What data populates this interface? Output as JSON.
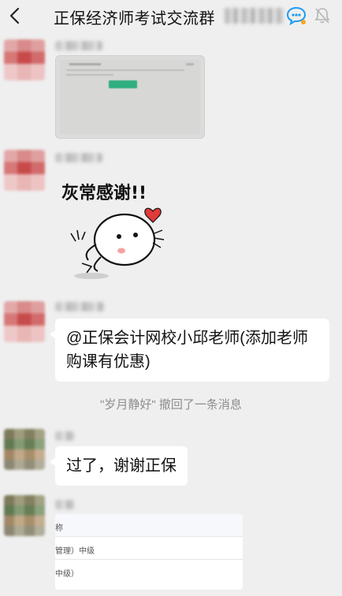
{
  "header": {
    "title": "正保经济师考试交流群",
    "back_icon": "chevron-left-icon",
    "chat_icon": "group-chat-icon",
    "bell_icon": "mute-bell-icon"
  },
  "messages": {
    "m3_text": "@正保会计网校小邱老师(添加老师购课有优惠)",
    "system_notice": "\"岁月静好\" 撤回了一条消息",
    "m4_text": "过了，谢谢正保"
  },
  "sticker": {
    "text": "灰常感谢!!"
  },
  "card": {
    "rows": [
      "称",
      "管理）中级",
      "中级）"
    ]
  },
  "colors": {
    "background": "#efefef",
    "bubble": "#ffffff",
    "accent_green": "#2fae7f",
    "chat_icon_blue": "#1d9bf0"
  }
}
